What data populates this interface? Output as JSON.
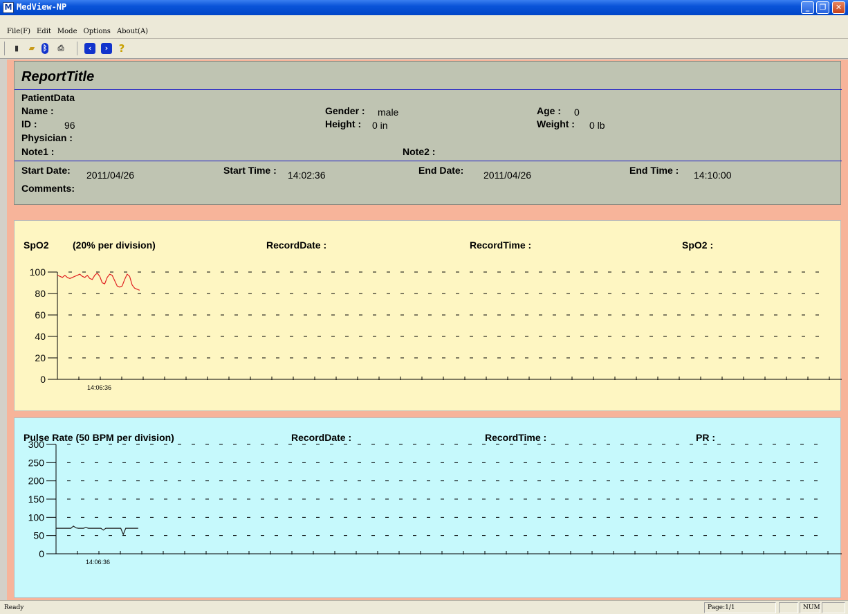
{
  "window": {
    "title": "MedView-NP",
    "min_icon": "minimize-icon",
    "max_icon": "restore-icon",
    "close_icon": "close-icon"
  },
  "menu": [
    "File(F)",
    "Edit",
    "Mode",
    "Options",
    "About(A)"
  ],
  "toolbar": {
    "icons": [
      "new-icon",
      "open-folder-icon",
      "bluetooth-icon",
      "print-icon",
      "previous-icon",
      "next-icon",
      "help-icon"
    ]
  },
  "report": {
    "title": "ReportTitle",
    "patient_data_label": "PatientData",
    "name_label": "Name :",
    "gender_label": "Gender :",
    "gender_value": "male",
    "age_label": "Age :",
    "age_value": "0",
    "id_label": "ID :",
    "id_value": "96",
    "height_label": "Height :",
    "height_value": "0 in",
    "weight_label": "Weight :",
    "weight_value": "0 lb",
    "physician_label": "Physician :",
    "note1_label": "Note1 :",
    "note2_label": "Note2 :",
    "start_date_label": "Start Date:",
    "start_date_value": "2011/04/26",
    "start_time_label": "Start Time :",
    "start_time_value": "14:02:36",
    "end_date_label": "End Date:",
    "end_date_value": "2011/04/26",
    "end_time_label": "End Time :",
    "end_time_value": "14:10:00",
    "comments_label": "Comments:"
  },
  "spo2_panel": {
    "title": "SpO2",
    "division": "(20% per division)",
    "record_date_label": "RecordDate :",
    "record_time_label": "RecordTime :",
    "value_label": "SpO2 :"
  },
  "pr_panel": {
    "title": "Pulse Rate (50 BPM per division)",
    "record_date_label": "RecordDate :",
    "record_time_label": "RecordTime :",
    "value_label": "PR :"
  },
  "status": {
    "text": "Ready",
    "page": "Page:1/1",
    "num": "NUM"
  },
  "colors": {
    "spo2_line": "#e02020",
    "pr_line": "#202020"
  },
  "chart_data": [
    {
      "type": "line",
      "title": "SpO2",
      "ylim": [
        0,
        100
      ],
      "yticks": [
        0,
        20,
        40,
        60,
        80,
        100
      ],
      "x_tick_label": "14:06:36",
      "series": [
        {
          "values": [
            97,
            96,
            95,
            97,
            95,
            94,
            95,
            96,
            97,
            98,
            96,
            95,
            97,
            94,
            93,
            97,
            99,
            96,
            90,
            89,
            95,
            98,
            97,
            92,
            87,
            86,
            87,
            93,
            98,
            96,
            88,
            85,
            84,
            83
          ]
        }
      ]
    },
    {
      "type": "line",
      "title": "Pulse Rate (50 BPM per division)",
      "ylim": [
        0,
        300
      ],
      "yticks": [
        0,
        50,
        100,
        150,
        200,
        250,
        300
      ],
      "x_tick_label": "14:06:36",
      "series": [
        {
          "values": [
            70,
            70,
            70,
            70,
            70,
            70,
            70,
            76,
            71,
            70,
            70,
            70,
            72,
            70,
            70,
            70,
            70,
            70,
            70,
            65,
            70,
            70,
            70,
            70,
            70,
            70,
            70,
            53,
            70,
            70,
            70,
            70,
            70,
            70
          ]
        }
      ]
    }
  ]
}
